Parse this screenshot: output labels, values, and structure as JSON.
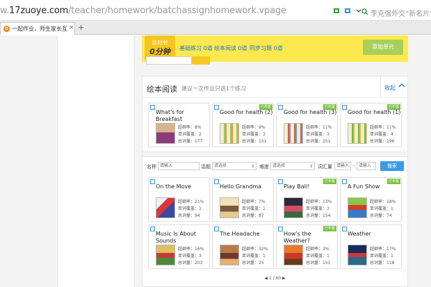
{
  "browser": {
    "url_prefix": "w.",
    "url_host": "17zuoye.com",
    "url_path": "/teacher/homework/batchassignhomework.vpage",
    "search_text": "李克强外交“新名片”",
    "tab_title": "一起作业，师生家长互动",
    "tab_favicon": "G",
    "tab_close": "×",
    "tab_new": "+"
  },
  "summary": {
    "time_label": "总时长",
    "time_value": "0分钟",
    "items": [
      {
        "label": "基础练习 0道"
      },
      {
        "label": "绘本阅读 0道"
      },
      {
        "label": "同步习题 0道"
      }
    ],
    "add_unit": "添加单元"
  },
  "panel": {
    "title": "绘本阅读",
    "hint": "建议一次作业只选1个练习",
    "collapse": "收起",
    "collapse_icon": "chevron-up-icon"
  },
  "featured": [
    {
      "title": "What's for Breakfast",
      "badge": "",
      "s1": "超纲率：8%",
      "s2": "单词覆盖：2",
      "s3": "总词量：177"
    },
    {
      "title": "Good for health (2)",
      "badge": "已布置",
      "s1": "超纲率：9%",
      "s2": "单词覆盖：3",
      "s3": "总词量：151"
    },
    {
      "title": "Good for health (3)",
      "badge": "已布置",
      "s1": "超纲率：11%",
      "s2": "单词覆盖：3",
      "s3": "总词量：151"
    },
    {
      "title": "Good for health (1)",
      "badge": "已布置",
      "s1": "超纲率：11%",
      "s2": "单词覆盖：4",
      "s3": "总词量：196"
    }
  ],
  "filter": {
    "name_label": "名称",
    "name_placeholder": "请输入",
    "topic_label": "话题",
    "topic_placeholder": "请选择",
    "level_label": "难度",
    "level_placeholder": "请选择",
    "vocab_label": "词汇量",
    "vocab_from_placeholder": "请输入",
    "vocab_dash": "-",
    "vocab_to_placeholder": "请输入",
    "search_button": "搜索"
  },
  "books": [
    {
      "title": "On the Move",
      "badge": "",
      "s1": "超纲率：21%",
      "s2": "单词覆盖：1",
      "s3": "总词量：94"
    },
    {
      "title": "Hello Grandma",
      "badge": "",
      "s1": "超纲率：7%",
      "s2": "单词覆盖：1",
      "s3": "总词量：87"
    },
    {
      "title": "Play Ball!",
      "badge": "已布置",
      "s1": "超纲率：13%",
      "s2": "单词覆盖：3",
      "s3": "总词量：154"
    },
    {
      "title": "A Fun Show",
      "badge": "已布置",
      "s1": "超纲率：18%",
      "s2": "单词覆盖：1",
      "s3": "总词量：74"
    },
    {
      "title": "Music Is About Sounds",
      "badge": "",
      "s1": "超纲率：16%",
      "s2": "单词覆盖：3",
      "s3": "总词量：203"
    },
    {
      "title": "The Headache",
      "badge": "",
      "s1": "超纲率：32%",
      "s2": "单词覆盖：1",
      "s3": "总词量：25"
    },
    {
      "title": "How's the Weather?",
      "badge": "已布置",
      "s1": "超纲率：3%",
      "s2": "单词覆盖：1",
      "s3": "总词量：151"
    },
    {
      "title": "Weather",
      "badge": "",
      "s1": "超纲率：17%",
      "s2": "单词覆盖：1",
      "s3": "总词量：118"
    }
  ],
  "pager": {
    "prev_icon": "chevron-left-icon",
    "text": "1 / 60",
    "next_icon": "chevron-right-icon"
  }
}
